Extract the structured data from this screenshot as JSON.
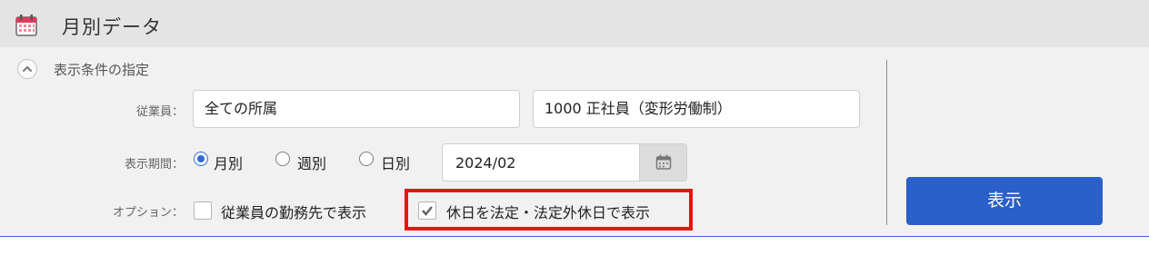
{
  "header": {
    "title": "月別データ",
    "icon": "calendar-icon"
  },
  "conditions": {
    "section_title": "表示条件の指定",
    "employee_label": "従業員：",
    "department_value": "全ての所属",
    "employee_value": "1000 正社員（変形労働制）",
    "period_label": "表示期間：",
    "period_options": [
      {
        "label": "月別",
        "selected": true
      },
      {
        "label": "週別",
        "selected": false
      },
      {
        "label": "日別",
        "selected": false
      }
    ],
    "date_value": "2024/02",
    "option_label": "オプション：",
    "options": [
      {
        "label": "従業員の勤務先で表示",
        "checked": false
      },
      {
        "label": "休日を法定・法定外休日で表示",
        "checked": true
      }
    ]
  },
  "actions": {
    "show_label": "表示"
  },
  "colors": {
    "accent": "#2b5fc9",
    "highlight": "#ee1111",
    "header_bg": "#e4e4e4",
    "panel_bg": "#f1f1f1"
  }
}
